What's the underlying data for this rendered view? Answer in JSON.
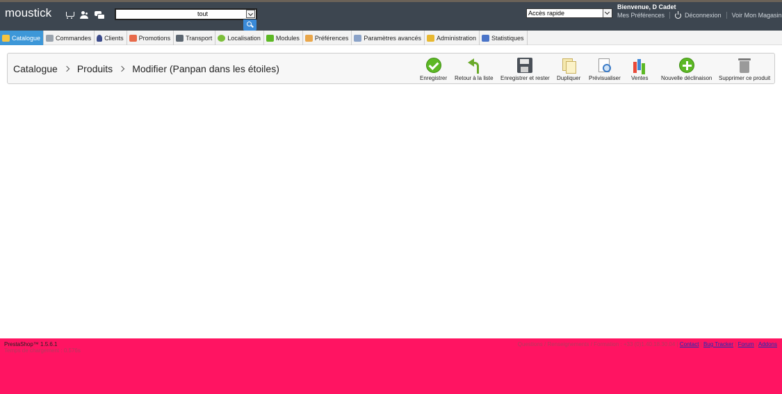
{
  "header": {
    "shop_name": "moustick",
    "icons": [
      "cart-icon",
      "people-icon",
      "chat-icon"
    ],
    "search": {
      "value": "",
      "scope": "tout"
    },
    "quick_access": "Accès rapide",
    "welcome": "Bienvenue, D Cadet",
    "my_preferences": "Mes Préférences",
    "logout": "Déconnexion",
    "view_shop": "Voir Mon Magasin"
  },
  "tabs": [
    {
      "label": "Catalogue",
      "icon": "folder-icon",
      "active": true
    },
    {
      "label": "Commandes",
      "icon": "cart-icon"
    },
    {
      "label": "Clients",
      "icon": "user-icon"
    },
    {
      "label": "Promotions",
      "icon": "tag-icon"
    },
    {
      "label": "Transport",
      "icon": "truck-icon"
    },
    {
      "label": "Localisation",
      "icon": "globe-icon"
    },
    {
      "label": "Modules",
      "icon": "puzzle-icon"
    },
    {
      "label": "Préférences",
      "icon": "window-icon"
    },
    {
      "label": "Paramètres avancés",
      "icon": "wrench-icon"
    },
    {
      "label": "Administration",
      "icon": "key-icon"
    },
    {
      "label": "Statistiques",
      "icon": "chart-icon"
    }
  ],
  "breadcrumb": [
    "Catalogue",
    "Produits",
    "Modifier (Panpan dans les étoiles)"
  ],
  "toolbar": {
    "save": "Enregistrer",
    "back": "Retour à la liste",
    "save_stay": "Enregistrer et rester",
    "duplicate": "Dupliquer",
    "preview": "Prévisualiser",
    "sales": "Ventes",
    "new_combination": "Nouvelle déclinaison",
    "delete": "Supprimer ce produit"
  },
  "footer": {
    "version": "PrestaShop™ 1.5.6.1",
    "load_time": "Temps de chargement : 0.576s",
    "info": "Questions / Renseignements / Formation : +33 (0)1.40.18.30.04",
    "links": [
      "Contact",
      "Bug Tracker",
      "Forum",
      "Addons"
    ]
  },
  "colors": {
    "header": "#3d4650",
    "active_tab": "#3d97d8",
    "footer": "#ff1462"
  }
}
